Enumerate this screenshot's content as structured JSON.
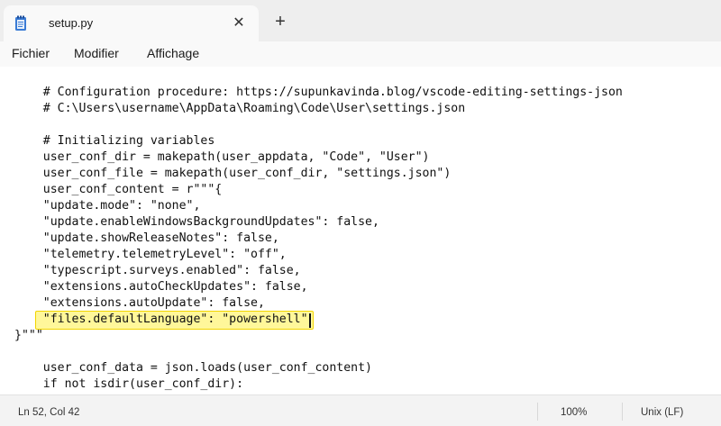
{
  "tab": {
    "title": "setup.py",
    "close": "✕",
    "new_tab": "+"
  },
  "menu": {
    "items": [
      "Fichier",
      "Modifier",
      "Affichage"
    ]
  },
  "editor": {
    "lines": [
      "    # Configuration procedure: https://supunkavinda.blog/vscode-editing-settings-json",
      "    # C:\\Users\\username\\AppData\\Roaming\\Code\\User\\settings.json",
      "",
      "    # Initializing variables",
      "    user_conf_dir = makepath(user_appdata, \"Code\", \"User\")",
      "    user_conf_file = makepath(user_conf_dir, \"settings.json\")",
      "    user_conf_content = r\"\"\"{",
      "    \"update.mode\": \"none\",",
      "    \"update.enableWindowsBackgroundUpdates\": false,",
      "    \"update.showReleaseNotes\": false,",
      "    \"telemetry.telemetryLevel\": \"off\",",
      "    \"typescript.surveys.enabled\": false,",
      "    \"extensions.autoCheckUpdates\": false,",
      "    \"extensions.autoUpdate\": false,",
      "    \"files.defaultLanguage\": \"powershell\"",
      "}\"\"\"",
      "",
      "    user_conf_data = json.loads(user_conf_content)",
      "    if not isdir(user_conf_dir):"
    ]
  },
  "status": {
    "position": "Ln 52, Col 42",
    "zoom": "100%",
    "line_ending": "Unix (LF)"
  }
}
